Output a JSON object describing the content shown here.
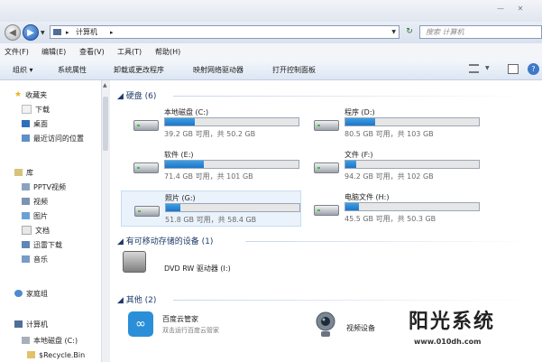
{
  "window": {
    "minimize_label": "—",
    "close_label": "✕"
  },
  "address": {
    "path_segment": "计算机",
    "search_placeholder": "搜索 计算机",
    "separator": "▸"
  },
  "menubar": [
    "文件(F)",
    "编辑(E)",
    "查看(V)",
    "工具(T)",
    "帮助(H)"
  ],
  "toolbar": {
    "organize": "组织 ▾",
    "items": [
      "系统属性",
      "卸载或更改程序",
      "映射网络驱动器",
      "打开控制面板"
    ]
  },
  "nav_pane": {
    "favorites": "收藏夹",
    "favorites_items": [
      "下载",
      "桌面",
      "最近访问的位置"
    ],
    "libraries": "库",
    "library_items": [
      "PPTV视频",
      "视频",
      "图片",
      "文档",
      "迅雷下载",
      "音乐"
    ],
    "homegroup": "家庭组",
    "computer": "计算机",
    "computer_items": [
      "本地磁盘 (C:)",
      "$Recycle.Bin"
    ]
  },
  "groups": {
    "hdd": "硬盘 (6)",
    "removable": "有可移动存储的设备 (1)",
    "other": "其他 (2)"
  },
  "drives": [
    {
      "name": "本地磁盘 (C:)",
      "info": "39.2 GB 可用，共 50.2 GB",
      "used_fraction": 0.22
    },
    {
      "name": "程序 (D:)",
      "info": "80.5 GB 可用，共 103 GB",
      "used_fraction": 0.22
    },
    {
      "name": "软件 (E:)",
      "info": "71.4 GB 可用，共 101 GB",
      "used_fraction": 0.29
    },
    {
      "name": "文件 (F:)",
      "info": "94.2 GB 可用，共 102 GB",
      "used_fraction": 0.08
    },
    {
      "name": "照片 (G:)",
      "info": "51.8 GB 可用，共 58.4 GB",
      "used_fraction": 0.11
    },
    {
      "name": "电脑文件 (H:)",
      "info": "45.5 GB 可用，共 50.3 GB",
      "used_fraction": 0.1
    }
  ],
  "dvd": {
    "label": "DVD RW 驱动器 (I:)"
  },
  "other_items": {
    "baidu_name": "百度云管家",
    "baidu_desc": "双击运行百度云管家",
    "webcam": "视频设备"
  },
  "watermark": {
    "title": "阳光系统",
    "url": "www.010dh.com"
  },
  "colors": {
    "accent": "#1f74c7",
    "header_text": "#1e3a6a"
  }
}
